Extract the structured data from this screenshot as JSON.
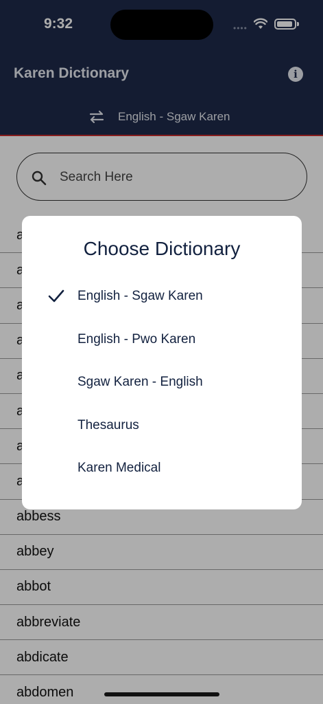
{
  "status_bar": {
    "time": "9:32",
    "signal_text": "••••"
  },
  "header": {
    "title": "Karen Dictionary",
    "info_icon": "info-icon",
    "current_dictionary": "English - Sgaw Karen",
    "swap_icon": "swap-arrows-icon"
  },
  "search": {
    "placeholder": "Search Here",
    "value": ""
  },
  "word_list": [
    "a",
    "a",
    "a",
    "a",
    "a",
    "a",
    "a",
    "a",
    "abbess",
    "abbey",
    "abbot",
    "abbreviate",
    "abdicate",
    "abdomen"
  ],
  "modal": {
    "title": "Choose Dictionary",
    "options": [
      {
        "label": "English - Sgaw Karen",
        "selected": true
      },
      {
        "label": "English - Pwo Karen",
        "selected": false
      },
      {
        "label": "Sgaw Karen - English",
        "selected": false
      },
      {
        "label": "Thesaurus",
        "selected": false
      },
      {
        "label": "Karen Medical",
        "selected": false
      }
    ]
  },
  "colors": {
    "header_bg": "#1e2a4a",
    "accent_red": "#c62a2a",
    "modal_text": "#12213f"
  }
}
